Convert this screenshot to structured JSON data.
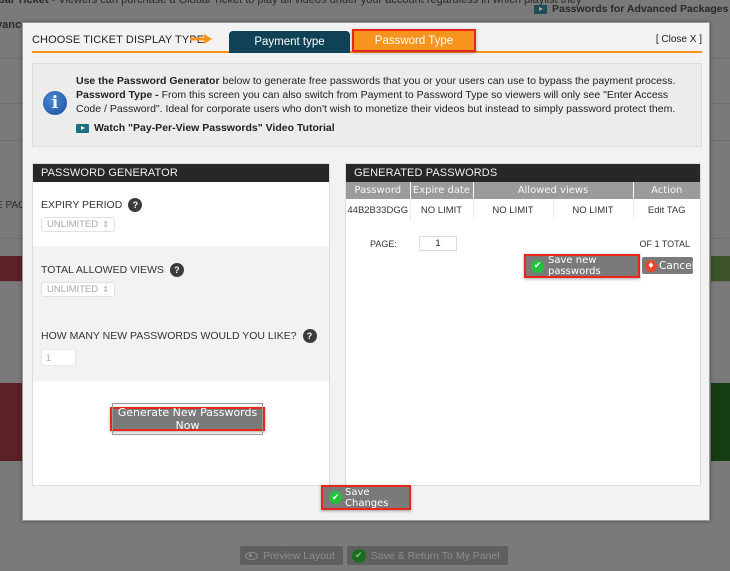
{
  "background": {
    "top_text_bold": "bal Ticket",
    "top_text": " - Viewers can purchase a Global Ticket to play all videos under your account regardless in which playlist they",
    "advanced_link": "Passwords for Advanced Packages",
    "left_label_1": "vance",
    "left_label_2": "E PAC",
    "bottom_buttons": [
      {
        "label": "Preview Layout",
        "icon": "eye-icon"
      },
      {
        "label": "Save & Return To My Panel",
        "icon": "check-icon"
      }
    ]
  },
  "modal": {
    "header": {
      "choose_label": "CHOOSE TICKET DISPLAY TYPE",
      "tabs": [
        {
          "label": "Payment type",
          "active": false
        },
        {
          "label": "Password Type",
          "active": true
        }
      ],
      "close_label": "[ Close X ]"
    },
    "info": {
      "line1_bold": "Use the Password Generator",
      "line1_rest": " below to generate free passwords that you or your users can use to bypass the payment process.",
      "line2_bold": "Password Type - ",
      "line2_rest": "From this screen you can also switch from Payment to Password Type so viewers will only see  \"Enter Access Code / Password\". Ideal for corporate users who don't wish to monetize their videos but instead to simply password protect them.",
      "video_link": "Watch \"Pay-Per-View Passwords\" Video Tutorial"
    },
    "generator": {
      "title": "PASSWORD GENERATOR",
      "expiry_label": "EXPIRY PERIOD",
      "expiry_value": "UNLIMITED",
      "views_label": "TOTAL ALLOWED VIEWS",
      "views_value": "UNLIMITED",
      "count_label": "HOW MANY NEW PASSWORDS WOULD YOU LIKE?",
      "count_value": "1",
      "help_glyph": "?",
      "generate_button": "Generate New Passwords Now"
    },
    "generated": {
      "title": "GENERATED PASSWORDS",
      "columns": [
        "Password",
        "Expire date",
        "Allowed views",
        "Action"
      ],
      "rows": [
        {
          "password": "44B2B33DGG",
          "expire": "NO LIMIT",
          "views_a": "NO LIMIT",
          "views_b": "NO LIMIT",
          "action": "Edit TAG"
        }
      ],
      "page_label": "PAGE:",
      "page_value": "1",
      "total_label": "OF 1 TOTAL",
      "save_button": "Save new passwords",
      "cancel_button": "Cancel"
    },
    "save_changes_button": "Save Changes"
  },
  "colors": {
    "accent_orange": "#f7941d",
    "tab_dark": "#0f4256",
    "highlight_red": "#e8261c",
    "success_green": "#22c33a"
  }
}
